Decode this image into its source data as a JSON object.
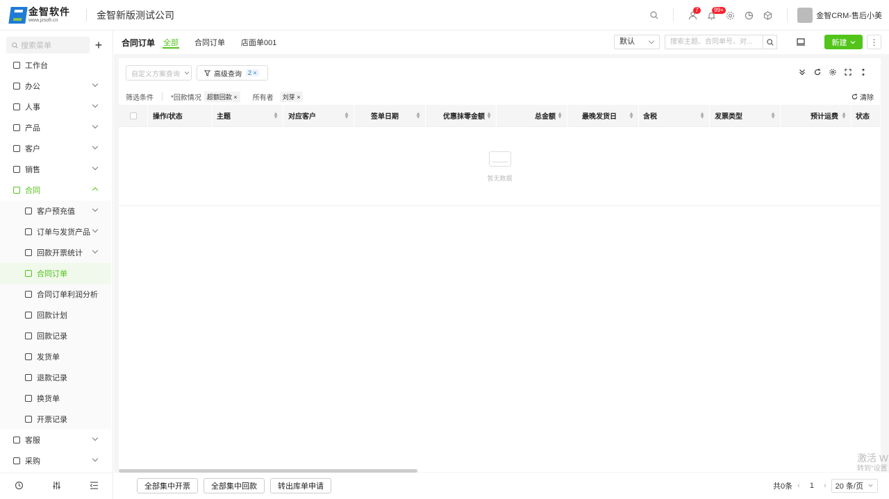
{
  "header": {
    "logo_cn": "金智软件",
    "logo_url": "www.jzsoft.cn",
    "company": "金智新版测试公司",
    "badge_contacts": "7",
    "badge_notices": "99+",
    "username": "金智CRM-售后小美"
  },
  "sidebar": {
    "search_placeholder": "搜索菜单",
    "items": [
      {
        "label": "工作台"
      },
      {
        "label": "办公"
      },
      {
        "label": "人事"
      },
      {
        "label": "产品"
      },
      {
        "label": "客户"
      },
      {
        "label": "销售"
      },
      {
        "label": "合同"
      }
    ],
    "sub_items": [
      {
        "label": "客户预充值"
      },
      {
        "label": "订单与发货产品"
      },
      {
        "label": "回款开票统计"
      },
      {
        "label": "合同订单"
      },
      {
        "label": "合同订单利润分析"
      },
      {
        "label": "回款计划"
      },
      {
        "label": "回款记录"
      },
      {
        "label": "发货单"
      },
      {
        "label": "退款记录"
      },
      {
        "label": "换货单"
      },
      {
        "label": "开票记录"
      }
    ],
    "tail_items": [
      {
        "label": "客服"
      },
      {
        "label": "采购"
      }
    ]
  },
  "tabs": {
    "title": "合同订单",
    "items": [
      "全部",
      "合同订单",
      "店面单001"
    ]
  },
  "toolbar": {
    "view_select": "默认",
    "search_placeholder": "搜索主题、合同单号、对...",
    "new_label": "新建"
  },
  "filters": {
    "scheme_placeholder": "自定义方案查询",
    "advanced_label": "高级查询",
    "advanced_count": "2",
    "conditions_label": "筛选条件",
    "cond1_label": "*回款情况",
    "cond1_value": "超额回款",
    "cond2_label": "所有者",
    "cond2_value": "刘芽",
    "clear_label": "清除"
  },
  "table": {
    "columns": [
      "操作/状态",
      "主题",
      "对应客户",
      "签单日期",
      "优惠抹零金额",
      "总金额",
      "最晚发货日",
      "含税",
      "发票类型",
      "预计运费",
      "状态"
    ],
    "empty_text": "暂无数据"
  },
  "footer": {
    "buttons": [
      "全部集中开票",
      "全部集中回款",
      "转出库单申请"
    ],
    "total": "共0条",
    "page": "1",
    "page_size": "20 条/页"
  },
  "watermark": {
    "line1": "激活 W",
    "line2": "转到\"设置"
  }
}
